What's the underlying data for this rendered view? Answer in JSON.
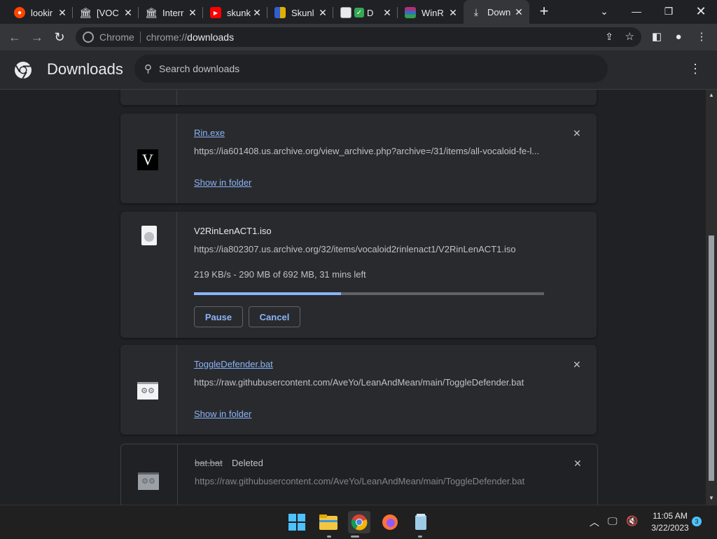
{
  "tabs": [
    {
      "title": "lookir",
      "icon": "reddit-icon",
      "color": "#ff4500"
    },
    {
      "title": "[VOC",
      "icon": "archive-icon",
      "color": "#e8eaed"
    },
    {
      "title": "Interr",
      "icon": "archive-icon",
      "color": "#e8eaed"
    },
    {
      "title": "skunk",
      "icon": "youtube-icon",
      "color": "#ff0000"
    },
    {
      "title": "Skunl",
      "icon": "skunk-site-icon",
      "color": "#e0b000"
    },
    {
      "title": "D",
      "icon": "docs-icon",
      "color": "#34a853"
    },
    {
      "title": "WinR",
      "icon": "winrar-icon",
      "color": "#b0307a"
    },
    {
      "title": "Down",
      "icon": "download-icon",
      "color": "#e8eaed"
    }
  ],
  "omnibox": {
    "site": "Chrome",
    "url_prefix": "chrome://",
    "url_path": "downloads"
  },
  "header": {
    "title": "Downloads",
    "search_placeholder": "Search downloads"
  },
  "downloads": [
    {
      "name": "Rin.exe",
      "url": "https://ia601408.us.archive.org/view_archive.php?archive=/31/items/all-vocaloid-fe-l...",
      "action": "Show in folder",
      "icon": "vocaloid-v3-icon"
    },
    {
      "name": "V2RinLenACT1.iso",
      "url": "https://ia802307.us.archive.org/32/items/vocaloid2rinlenact1/V2RinLenACT1.iso",
      "status": "219 KB/s - 290 MB of 692 MB, 31 mins left",
      "progress": 0.42,
      "pause_label": "Pause",
      "cancel_label": "Cancel",
      "icon": "disc-image-icon"
    },
    {
      "name": "ToggleDefender.bat",
      "url": "https://raw.githubusercontent.com/AveYo/LeanAndMean/main/ToggleDefender.bat",
      "action": "Show in folder",
      "icon": "batch-file-icon"
    },
    {
      "name": "bat.bat",
      "deleted_label": "Deleted",
      "url": "https://raw.githubusercontent.com/AveYo/LeanAndMean/main/ToggleDefender.bat",
      "icon": "batch-file-icon"
    }
  ],
  "taskbar": {
    "time": "11:05 AM",
    "date": "3/22/2023",
    "notification_count": "3"
  },
  "colors": {
    "accent": "#8ab4f8",
    "background": "#202124",
    "card": "#292a2d"
  }
}
